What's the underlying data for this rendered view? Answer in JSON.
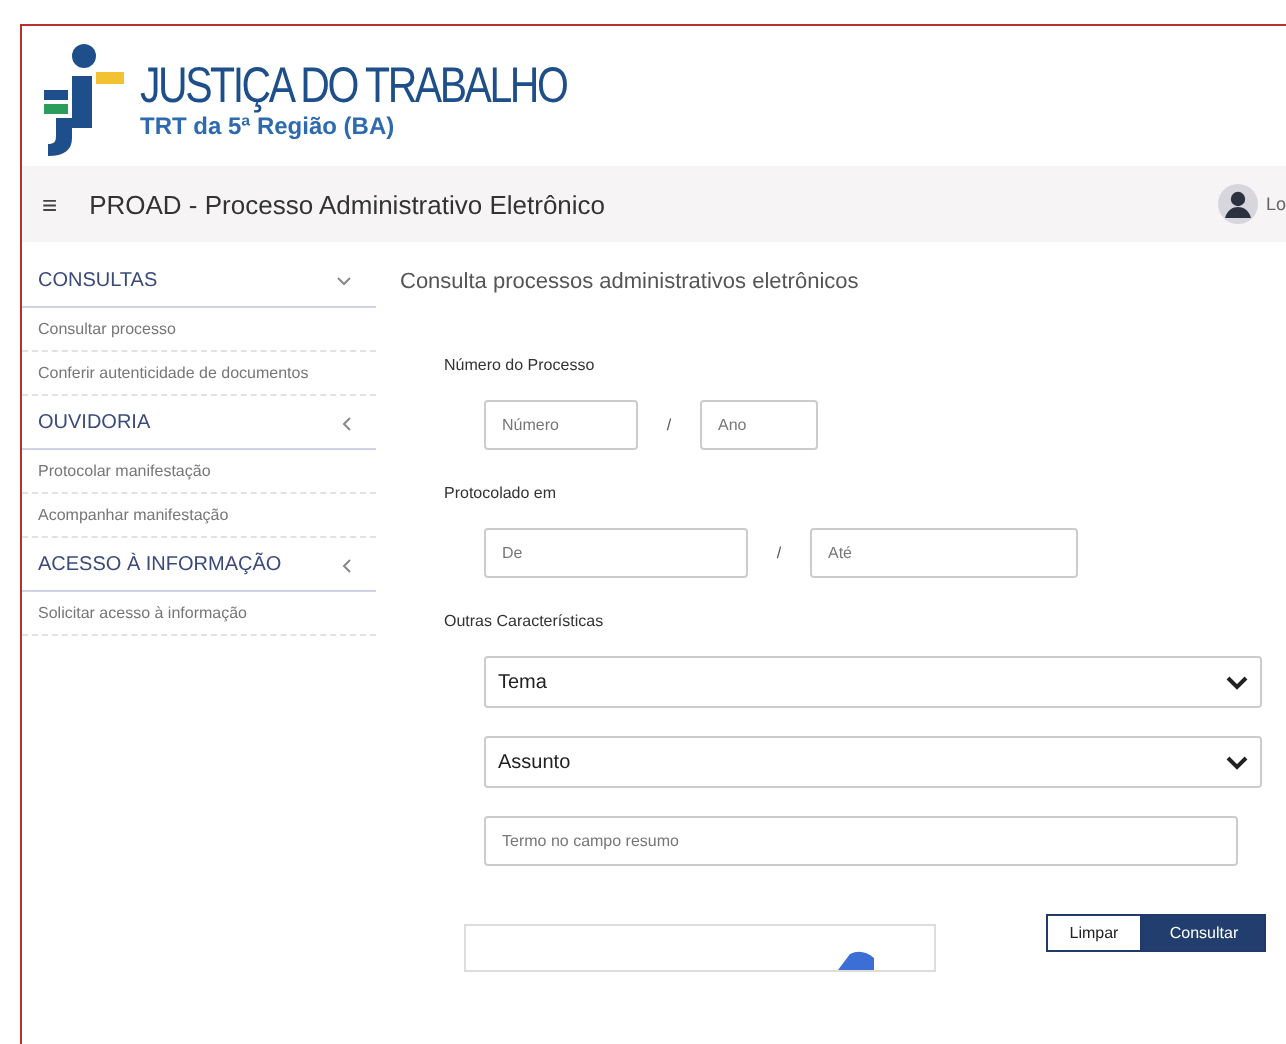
{
  "header": {
    "title": "JUSTIÇA DO TRABALHO",
    "subtitle": "TRT da 5ª Região (BA)"
  },
  "navbar": {
    "menu_icon": "≡",
    "title": "PROAD - Processo Administrativo Eletrônico",
    "user_label": "Lo"
  },
  "sidebar": {
    "sections": [
      {
        "label": "CONSULTAS",
        "expanded": true,
        "items": [
          "Consultar processo",
          "Conferir autenticidade de documentos"
        ]
      },
      {
        "label": "OUVIDORIA",
        "expanded": false,
        "items": [
          "Protocolar manifestação",
          "Acompanhar manifestação"
        ]
      },
      {
        "label": "ACESSO À INFORMAÇÃO",
        "expanded": false,
        "items": [
          "Solicitar acesso à informação"
        ]
      }
    ]
  },
  "main": {
    "title": "Consulta processos administrativos eletrônicos",
    "process_number": {
      "label": "Número do Processo",
      "number_placeholder": "Número",
      "separator": "/",
      "year_placeholder": "Ano"
    },
    "filed_on": {
      "label": "Protocolado em",
      "from_placeholder": "De",
      "separator": "/",
      "to_placeholder": "Até"
    },
    "other": {
      "label": "Outras Características",
      "selects": [
        "Tema",
        "Assunto"
      ],
      "summary_placeholder": "Termo no campo resumo"
    },
    "buttons": [
      {
        "label": "Limpar",
        "kind": "secondary"
      },
      {
        "label": "Consultar",
        "kind": "primary"
      }
    ]
  }
}
